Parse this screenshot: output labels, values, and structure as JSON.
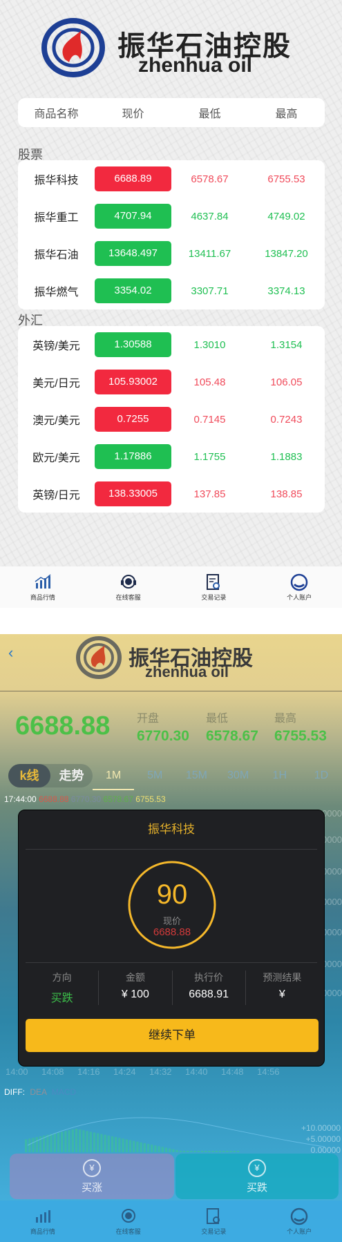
{
  "brand": {
    "cn": "振华石油控股",
    "en": "zhenhua oil"
  },
  "table_header": [
    "商品名称",
    "现价",
    "最低",
    "最高"
  ],
  "sections": {
    "stocks_label": "股票",
    "fx_label": "外汇"
  },
  "stocks": [
    {
      "name": "振华科技",
      "price": "6688.89",
      "low": "6578.67",
      "high": "6755.53",
      "dir": "up"
    },
    {
      "name": "振华重工",
      "price": "4707.94",
      "low": "4637.84",
      "high": "4749.02",
      "dir": "down"
    },
    {
      "name": "振华石油",
      "price": "13648.497",
      "low": "13411.67",
      "high": "13847.20",
      "dir": "down"
    },
    {
      "name": "振华燃气",
      "price": "3354.02",
      "low": "3307.71",
      "high": "3374.13",
      "dir": "down"
    }
  ],
  "fx": [
    {
      "name": "英镑/美元",
      "price": "1.30588",
      "low": "1.3010",
      "high": "1.3154",
      "dir": "down"
    },
    {
      "name": "美元/日元",
      "price": "105.93002",
      "low": "105.48",
      "high": "106.05",
      "dir": "up"
    },
    {
      "name": "澳元/美元",
      "price": "0.7255",
      "low": "0.7145",
      "high": "0.7243",
      "dir": "up"
    },
    {
      "name": "欧元/美元",
      "price": "1.17886",
      "low": "1.1755",
      "high": "1.1883",
      "dir": "down"
    },
    {
      "name": "英镑/日元",
      "price": "138.33005",
      "low": "137.85",
      "high": "138.85",
      "dir": "up"
    }
  ],
  "tabs": [
    "商品行情",
    "在线客服",
    "交易记录",
    "个人账户"
  ],
  "colors": {
    "up": "#f2293f",
    "down": "#1fbf52",
    "accent": "#f7b91b"
  },
  "detail": {
    "back": "‹",
    "current_price": "6688.88",
    "open_label": "开盘",
    "open": "6770.30",
    "low_label": "最低",
    "low": "6578.67",
    "high_label": "最高",
    "high": "6755.53",
    "chart_modes": [
      "k线",
      "走势"
    ],
    "periods": [
      "1M",
      "5M",
      "15M",
      "30M",
      "1H",
      "1D"
    ],
    "quote_time": "17:44:00",
    "quote_values": [
      "6688.88",
      "6770.30",
      "6578.67",
      "6755.53"
    ],
    "y_labels": [
      "0000",
      "0000",
      "0000",
      "0000",
      "0000",
      "0000",
      "0000"
    ],
    "x_labels": [
      "14:00",
      "14:08",
      "14:16",
      "14:24",
      "14:32",
      "14:40",
      "14:48",
      "14:56"
    ],
    "diff_label": "DIFF:",
    "dea_label": "DEA",
    "macd_label": "MACD",
    "macd_labels": [
      "+10.00000",
      "+5.00000",
      "0.00000"
    ],
    "buy_up": "买涨",
    "buy_down": "买跌",
    "buy_icon": "¥"
  },
  "modal": {
    "title": "振华科技",
    "countdown": "90",
    "countdown_fraction": 1.0,
    "price_label": "现价",
    "price": "6688.88",
    "direction_label": "方向",
    "direction": "买跌",
    "amount_label": "金额",
    "amount": "¥ 100",
    "exec_label": "执行价",
    "exec": "6688.91",
    "result_label": "预测结果",
    "result": "¥",
    "continue": "继续下单"
  }
}
